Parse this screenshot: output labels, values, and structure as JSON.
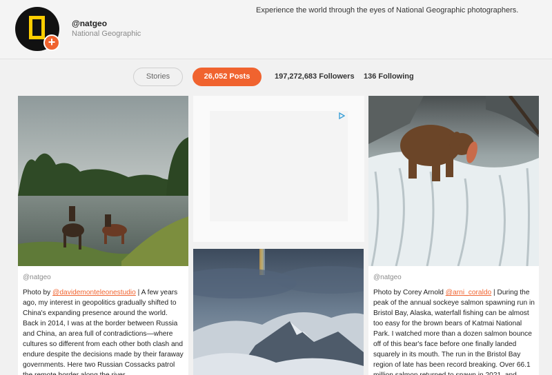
{
  "profile": {
    "handle": "@natgeo",
    "name": "National Geographic",
    "bio": "Experience the world through the eyes of National Geographic photographers.",
    "avatar_icon": "natgeo-logo-icon",
    "follow_icon": "plus-icon"
  },
  "stats": {
    "stories_label": "Stories",
    "posts_label": "26,052 Posts",
    "followers_label": "197,272,683 Followers",
    "following_label": "136 Following"
  },
  "colors": {
    "accent": "#f0632f",
    "logo_yellow": "#ffce00"
  },
  "posts": [
    {
      "author": "@natgeo",
      "caption_prefix": "Photo by ",
      "credit": "@davidemonteleonestudio",
      "caption": " | A few years ago, my interest in geopolitics gradually shifted to China's expanding presence around the world. Back in 2014, I was at the border between Russia and China, an area full of contradictions—where cultures so different from each other both clash and endure despite the decisions made by their faraway governments. Here two Russian Cossacks patrol the remote border along the river"
    },
    {
      "author": "",
      "caption": ""
    },
    {
      "author": "@natgeo",
      "caption_prefix": "Photo by Corey Arnold ",
      "credit": "@arni_coraldo",
      "caption": " | During the peak of the annual sockeye salmon spawning run in Bristol Bay, Alaska, waterfall fishing can be almost too easy for the brown bears of Katmai National Park. I watched more than a dozen salmon bounce off of this bear's face before one finally landed squarely in its mouth. The run in the Bristol Bay region of late has been record breaking. Over 66.1 million salmon returned to spawn in 2021, and"
    }
  ],
  "ad": {
    "icon": "adchoices-icon"
  }
}
